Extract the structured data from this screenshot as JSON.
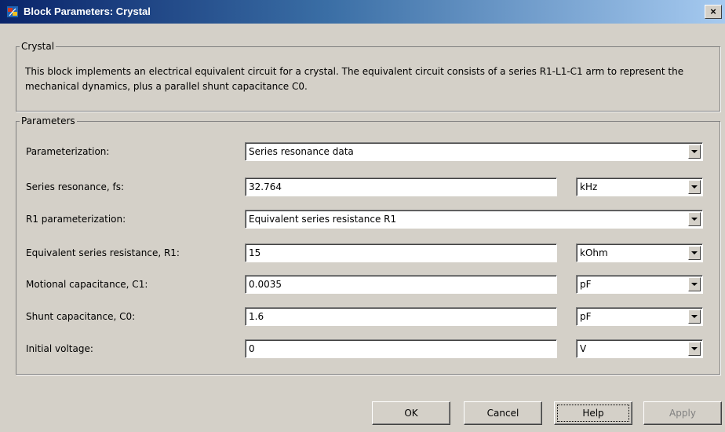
{
  "window": {
    "title": "Block Parameters: Crystal",
    "close_label": "×"
  },
  "description_group": {
    "legend": "Crystal",
    "text": "This block implements an electrical equivalent circuit for a crystal. The equivalent circuit consists of a series R1-L1-C1 arm to represent the mechanical dynamics, plus a parallel shunt capacitance C0."
  },
  "parameters": {
    "legend": "Parameters",
    "parameterization": {
      "label": "Parameterization:",
      "value": "Series resonance data"
    },
    "series_resonance": {
      "label": "Series resonance, fs:",
      "value": "32.764",
      "unit": "kHz"
    },
    "r1_parameterization": {
      "label": "R1 parameterization:",
      "value": "Equivalent series resistance R1"
    },
    "r1": {
      "label": "Equivalent series resistance, R1:",
      "value": "15",
      "unit": "kOhm"
    },
    "c1": {
      "label": "Motional capacitance, C1:",
      "value": "0.0035",
      "unit": "pF"
    },
    "c0": {
      "label": "Shunt capacitance, C0:",
      "value": "1.6",
      "unit": "pF"
    },
    "initial_voltage": {
      "label": "Initial voltage:",
      "value": "0",
      "unit": "V"
    }
  },
  "buttons": {
    "ok": "OK",
    "cancel": "Cancel",
    "help": "Help",
    "apply": "Apply"
  }
}
